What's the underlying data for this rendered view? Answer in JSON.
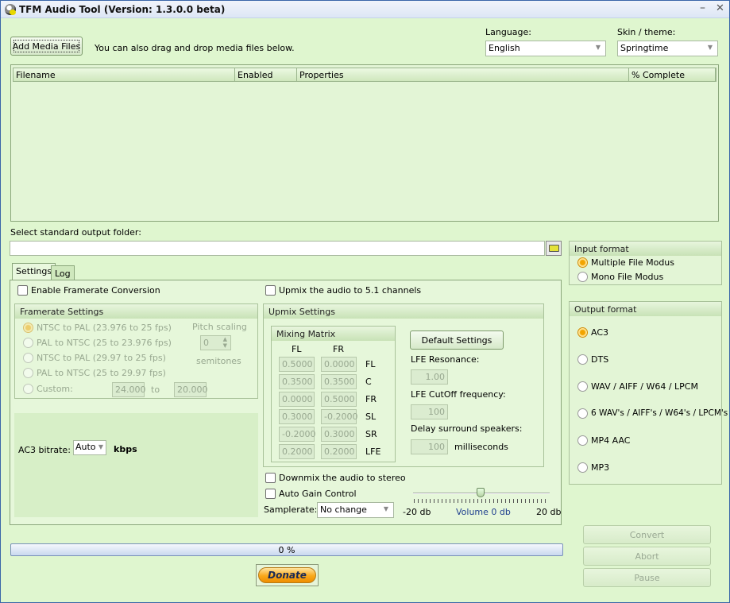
{
  "window": {
    "title": "TFM Audio Tool   (Version: 1.3.0.0 beta)",
    "minimize_glyph": "–",
    "close_glyph": "✕"
  },
  "top": {
    "add_media_label": "Add Media Files",
    "drag_hint": "You can also drag and drop media files below.",
    "language_label": "Language:",
    "language_value": "English",
    "skin_label": "Skin / theme:",
    "skin_value": "Springtime"
  },
  "file_list": {
    "columns": [
      "Filename",
      "Enabled",
      "Properties",
      "% Complete"
    ]
  },
  "output_folder": {
    "label": "Select standard output folder:",
    "value": ""
  },
  "tabs": [
    {
      "label": "Settings",
      "active": true
    },
    {
      "label": "Log",
      "active": false
    }
  ],
  "settings": {
    "framerate_checkbox": "Enable Framerate Conversion",
    "framerate_group": "Framerate Settings",
    "framerate_options": [
      "NTSC to PAL (23.976 to 25 fps)",
      "PAL to NTSC (25 to 23.976 fps)",
      "NTSC to PAL (29.97 to 25 fps)",
      "PAL to NTSC (25 to 29.97 fps)",
      "Custom:"
    ],
    "custom_from": "24.000",
    "custom_to_label": "to",
    "custom_to": "20.000",
    "pitch_label": "Pitch scaling",
    "pitch_value": "0",
    "semitones_label": "semitones",
    "ac3_bitrate_label": "AC3 bitrate:",
    "ac3_bitrate_value": "Auto",
    "kbps_label": "kbps",
    "upmix_checkbox": "Upmix the audio to 5.1 channels",
    "upmix_group": "Upmix Settings",
    "matrix_group": "Mixing Matrix",
    "matrix_col_headers": [
      "FL",
      "FR"
    ],
    "matrix_rows": [
      {
        "label": "FL",
        "fl": "0.5000",
        "fr": "0.0000"
      },
      {
        "label": "C",
        "fl": "0.3500",
        "fr": "0.3500"
      },
      {
        "label": "FR",
        "fl": "0.0000",
        "fr": "0.5000"
      },
      {
        "label": "SL",
        "fl": "0.3000",
        "fr": "-0.2000"
      },
      {
        "label": "SR",
        "fl": "-0.2000",
        "fr": "0.3000"
      },
      {
        "label": "LFE",
        "fl": "0.2000",
        "fr": "0.2000"
      }
    ],
    "default_settings_label": "Default Settings",
    "lfe_resonance_label": "LFE Resonance:",
    "lfe_resonance_value": "1.00",
    "lfe_cutoff_label": "LFE CutOff frequency:",
    "lfe_cutoff_value": "100",
    "delay_label": "Delay surround speakers:",
    "delay_value": "100",
    "delay_unit": "milliseconds",
    "downmix_checkbox": "Downmix the audio to stereo",
    "agc_checkbox": "Auto Gain Control",
    "samplerate_label": "Samplerate:",
    "samplerate_value": "No change",
    "volume_min_label": "-20 db",
    "volume_label": "Volume 0 db",
    "volume_max_label": "20 db",
    "volume_db": 0
  },
  "input_format": {
    "title": "Input format",
    "options": [
      "Multiple File Modus",
      "Mono File Modus"
    ],
    "selected": 0
  },
  "output_format": {
    "title": "Output format",
    "options": [
      "AC3",
      "DTS",
      "WAV / AIFF / W64 / LPCM",
      "6 WAV's / AIFF's / W64's / LPCM's",
      "MP4 AAC",
      "MP3"
    ],
    "selected": 0
  },
  "bottom": {
    "progress_text": "0 %",
    "progress_percent": 0,
    "donate_label": "Donate",
    "convert_label": "Convert",
    "abort_label": "Abort",
    "pause_label": "Pause"
  },
  "colors": {
    "background": "#dff6cf",
    "accent_radio": "#f2a400",
    "volume_text": "#1f3f8f"
  }
}
